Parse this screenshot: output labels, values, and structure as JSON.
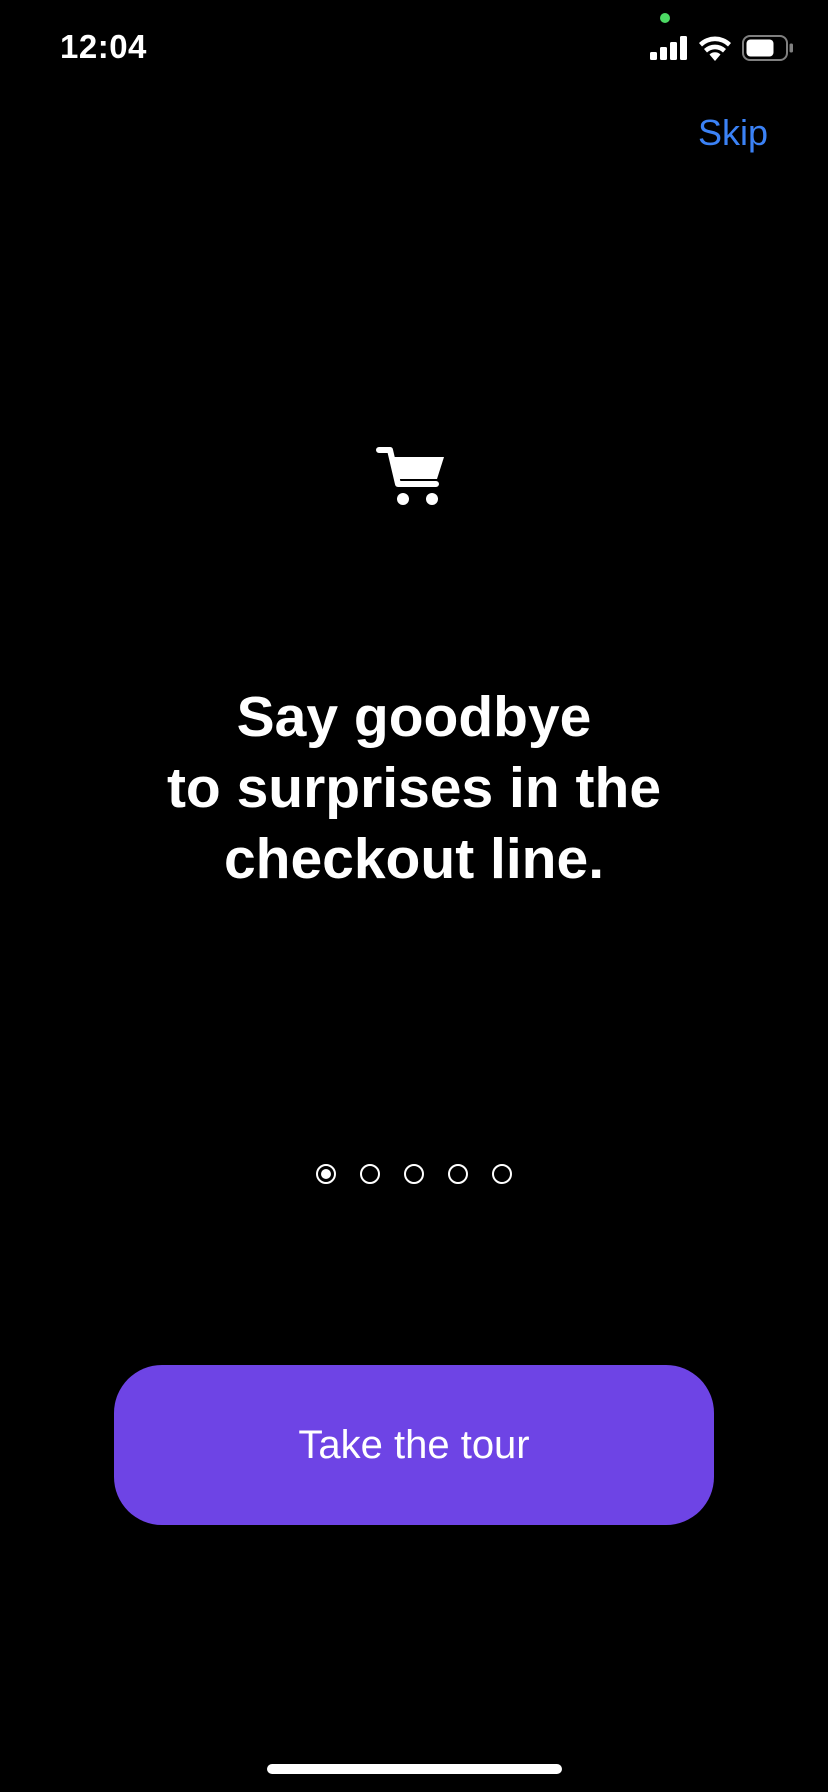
{
  "status_bar": {
    "time": "12:04",
    "privacy_dot_color": "#4cd964",
    "icons": [
      "cellular-signal-icon",
      "wifi-icon",
      "battery-icon"
    ]
  },
  "nav": {
    "skip_label": "Skip",
    "skip_color": "#3b82f6"
  },
  "hero": {
    "icon": "shopping-cart-icon",
    "headline_lines": [
      "Say goodbye",
      "to surprises in the",
      "checkout line."
    ]
  },
  "pager": {
    "page_count": 5,
    "current_page": 1
  },
  "cta": {
    "label": "Take the tour",
    "color": "#6e44e5"
  }
}
